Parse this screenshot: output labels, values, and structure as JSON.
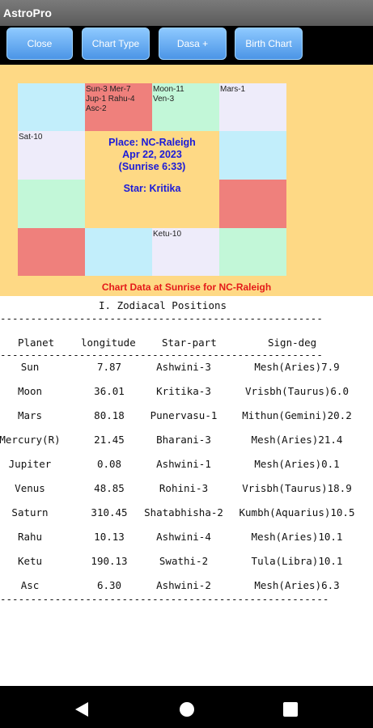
{
  "app": {
    "title": "AstroPro"
  },
  "toolbar": {
    "buttons": [
      "Close",
      "Chart Type",
      "Dasa +",
      "Birth Chart"
    ]
  },
  "chart": {
    "cells": {
      "r0c1": "Sun-3 Mer-7\nJup-1 Rahu-4\nAsc-2",
      "r0c2": "Moon-11\nVen-3",
      "r0c3": "Mars-1",
      "r1c0": "Sat-10",
      "r3c2": "Ketu-10"
    },
    "center": {
      "place": "Place: NC-Raleigh",
      "date": "Apr 22, 2023",
      "sunrise": "(Sunrise 6:33)",
      "star": "Star: Kritika"
    },
    "caption": "Chart Data at Sunrise for NC-Raleigh",
    "colors": {
      "blue": "#c2eefb",
      "red": "#ef807c",
      "green": "#c2f7d8",
      "lavender": "#eeecfa",
      "panel": "#fed985"
    }
  },
  "positions": {
    "section_title": "I. Zodiacal Positions",
    "separator": "-------------------------------------------------------------",
    "headers": {
      "planet": "Planet",
      "longitude": "longitude",
      "star_part": "Star-part",
      "sign_deg": "Sign-deg"
    },
    "rows": [
      {
        "planet": "Sun",
        "longitude": "7.87",
        "star_part": "Ashwini-3",
        "sign_deg": "Mesh(Aries)7.9"
      },
      {
        "planet": "Moon",
        "longitude": "36.01",
        "star_part": "Kritika-3",
        "sign_deg": "Vrisbh(Taurus)6.0"
      },
      {
        "planet": "Mars",
        "longitude": "80.18",
        "star_part": "Punervasu-1",
        "sign_deg": "Mithun(Gemini)20.2"
      },
      {
        "planet": "Mercury(R)",
        "longitude": "21.45",
        "star_part": "Bharani-3",
        "sign_deg": "Mesh(Aries)21.4"
      },
      {
        "planet": "Jupiter",
        "longitude": "0.08",
        "star_part": "Ashwini-1",
        "sign_deg": "Mesh(Aries)0.1"
      },
      {
        "planet": "Venus",
        "longitude": "48.85",
        "star_part": "Rohini-3",
        "sign_deg": "Vrisbh(Taurus)18.9"
      },
      {
        "planet": "Saturn",
        "longitude": "310.45",
        "star_part": "Shatabhisha-2",
        "sign_deg": "Kumbh(Aquarius)10.5"
      },
      {
        "planet": "Rahu",
        "longitude": "10.13",
        "star_part": "Ashwini-4",
        "sign_deg": "Mesh(Aries)10.1"
      },
      {
        "planet": "Ketu",
        "longitude": "190.13",
        "star_part": "Swathi-2",
        "sign_deg": "Tula(Libra)10.1"
      },
      {
        "planet": "Asc",
        "longitude": "6.30",
        "star_part": "Ashwini-2",
        "sign_deg": "Mesh(Aries)6.3"
      }
    ]
  },
  "navbar": {
    "icons": [
      "back-icon",
      "home-icon",
      "recents-icon"
    ]
  }
}
